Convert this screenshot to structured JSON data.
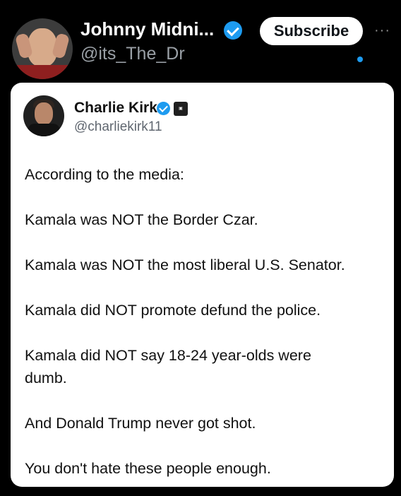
{
  "post": {
    "author_name": "Johnny Midni...",
    "author_handle": "@its_The_Dr",
    "subscribe_label": "Subscribe",
    "more_icon": "more-icon",
    "verified_icon": "verified-icon"
  },
  "quoted": {
    "author_name": "Charlie Kirk",
    "author_handle": "@charliekirk11",
    "verified_icon": "verified-icon",
    "badge_icon": "affiliate-badge-icon",
    "lines": [
      "According to the media:",
      "Kamala was NOT the Border Czar.",
      "Kamala was NOT the most liberal U.S. Senator.",
      "Kamala did NOT promote defund the police.",
      "Kamala did NOT say 18-24 year-olds were",
      "dumb.",
      "And Donald Trump never got shot.",
      "You don't hate these people enough."
    ]
  },
  "colors": {
    "background": "#000000",
    "card": "#ffffff",
    "accent": "#1d9bf0",
    "handle": "#9aa0a6"
  }
}
